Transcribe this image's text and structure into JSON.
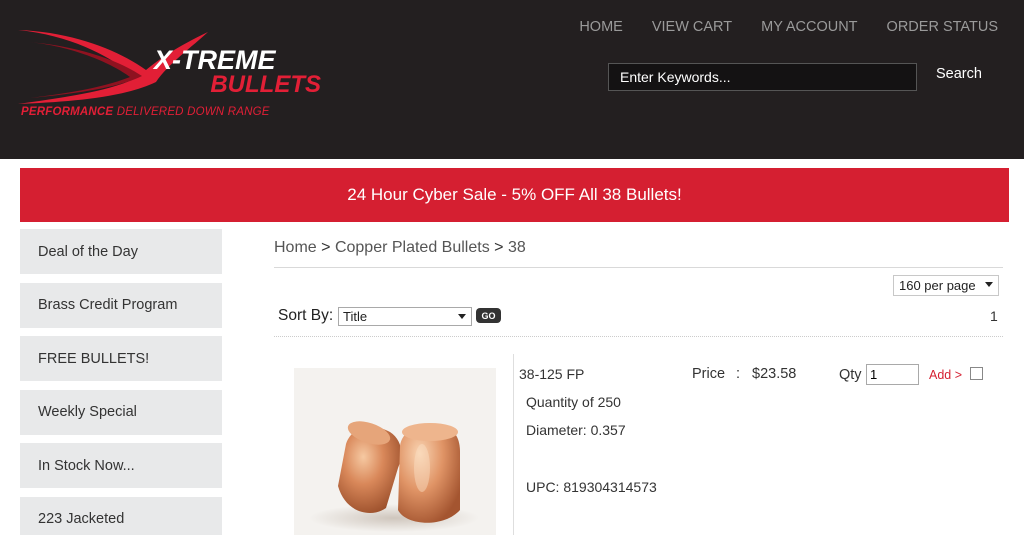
{
  "header": {
    "logo": {
      "line1": "X-TREME",
      "line2": "BULLETS",
      "tagline_bold": "PERFORMANCE",
      "tagline_rest": "DELIVERED DOWN RANGE"
    },
    "nav": [
      "HOME",
      "VIEW CART",
      "MY ACCOUNT",
      "ORDER STATUS"
    ],
    "search": {
      "placeholder": "Enter Keywords...",
      "button": "Search"
    }
  },
  "banner": {
    "text": "24 Hour Cyber Sale - 5% OFF All 38 Bullets!"
  },
  "sidebar": {
    "items": [
      {
        "label": "Deal of the Day"
      },
      {
        "label": "Brass Credit Program"
      },
      {
        "label": "FREE BULLETS!"
      },
      {
        "label": "Weekly Special"
      },
      {
        "label": "In Stock Now..."
      },
      {
        "label": "223 Jacketed"
      }
    ]
  },
  "breadcrumb": {
    "home": "Home",
    "sep": ">",
    "category": "Copper Plated Bullets",
    "current": "38"
  },
  "listing": {
    "per_page": "160 per page",
    "sort_label": "Sort By:",
    "sort_value": "Title",
    "go_label": "GO",
    "page": "1"
  },
  "product": {
    "name": "38-125 FP",
    "quantity": "Quantity of 250",
    "diameter": "Diameter: 0.357",
    "upc": "UPC: 819304314573",
    "price_label": "Price",
    "price_sep": ":",
    "price": "$23.58",
    "qty_label": "Qty",
    "qty_value": "1",
    "add_label": "Add >"
  },
  "colors": {
    "header_bg": "#231f20",
    "brand_red": "#d51f31",
    "sidebar_bg": "#e8e9ea"
  }
}
